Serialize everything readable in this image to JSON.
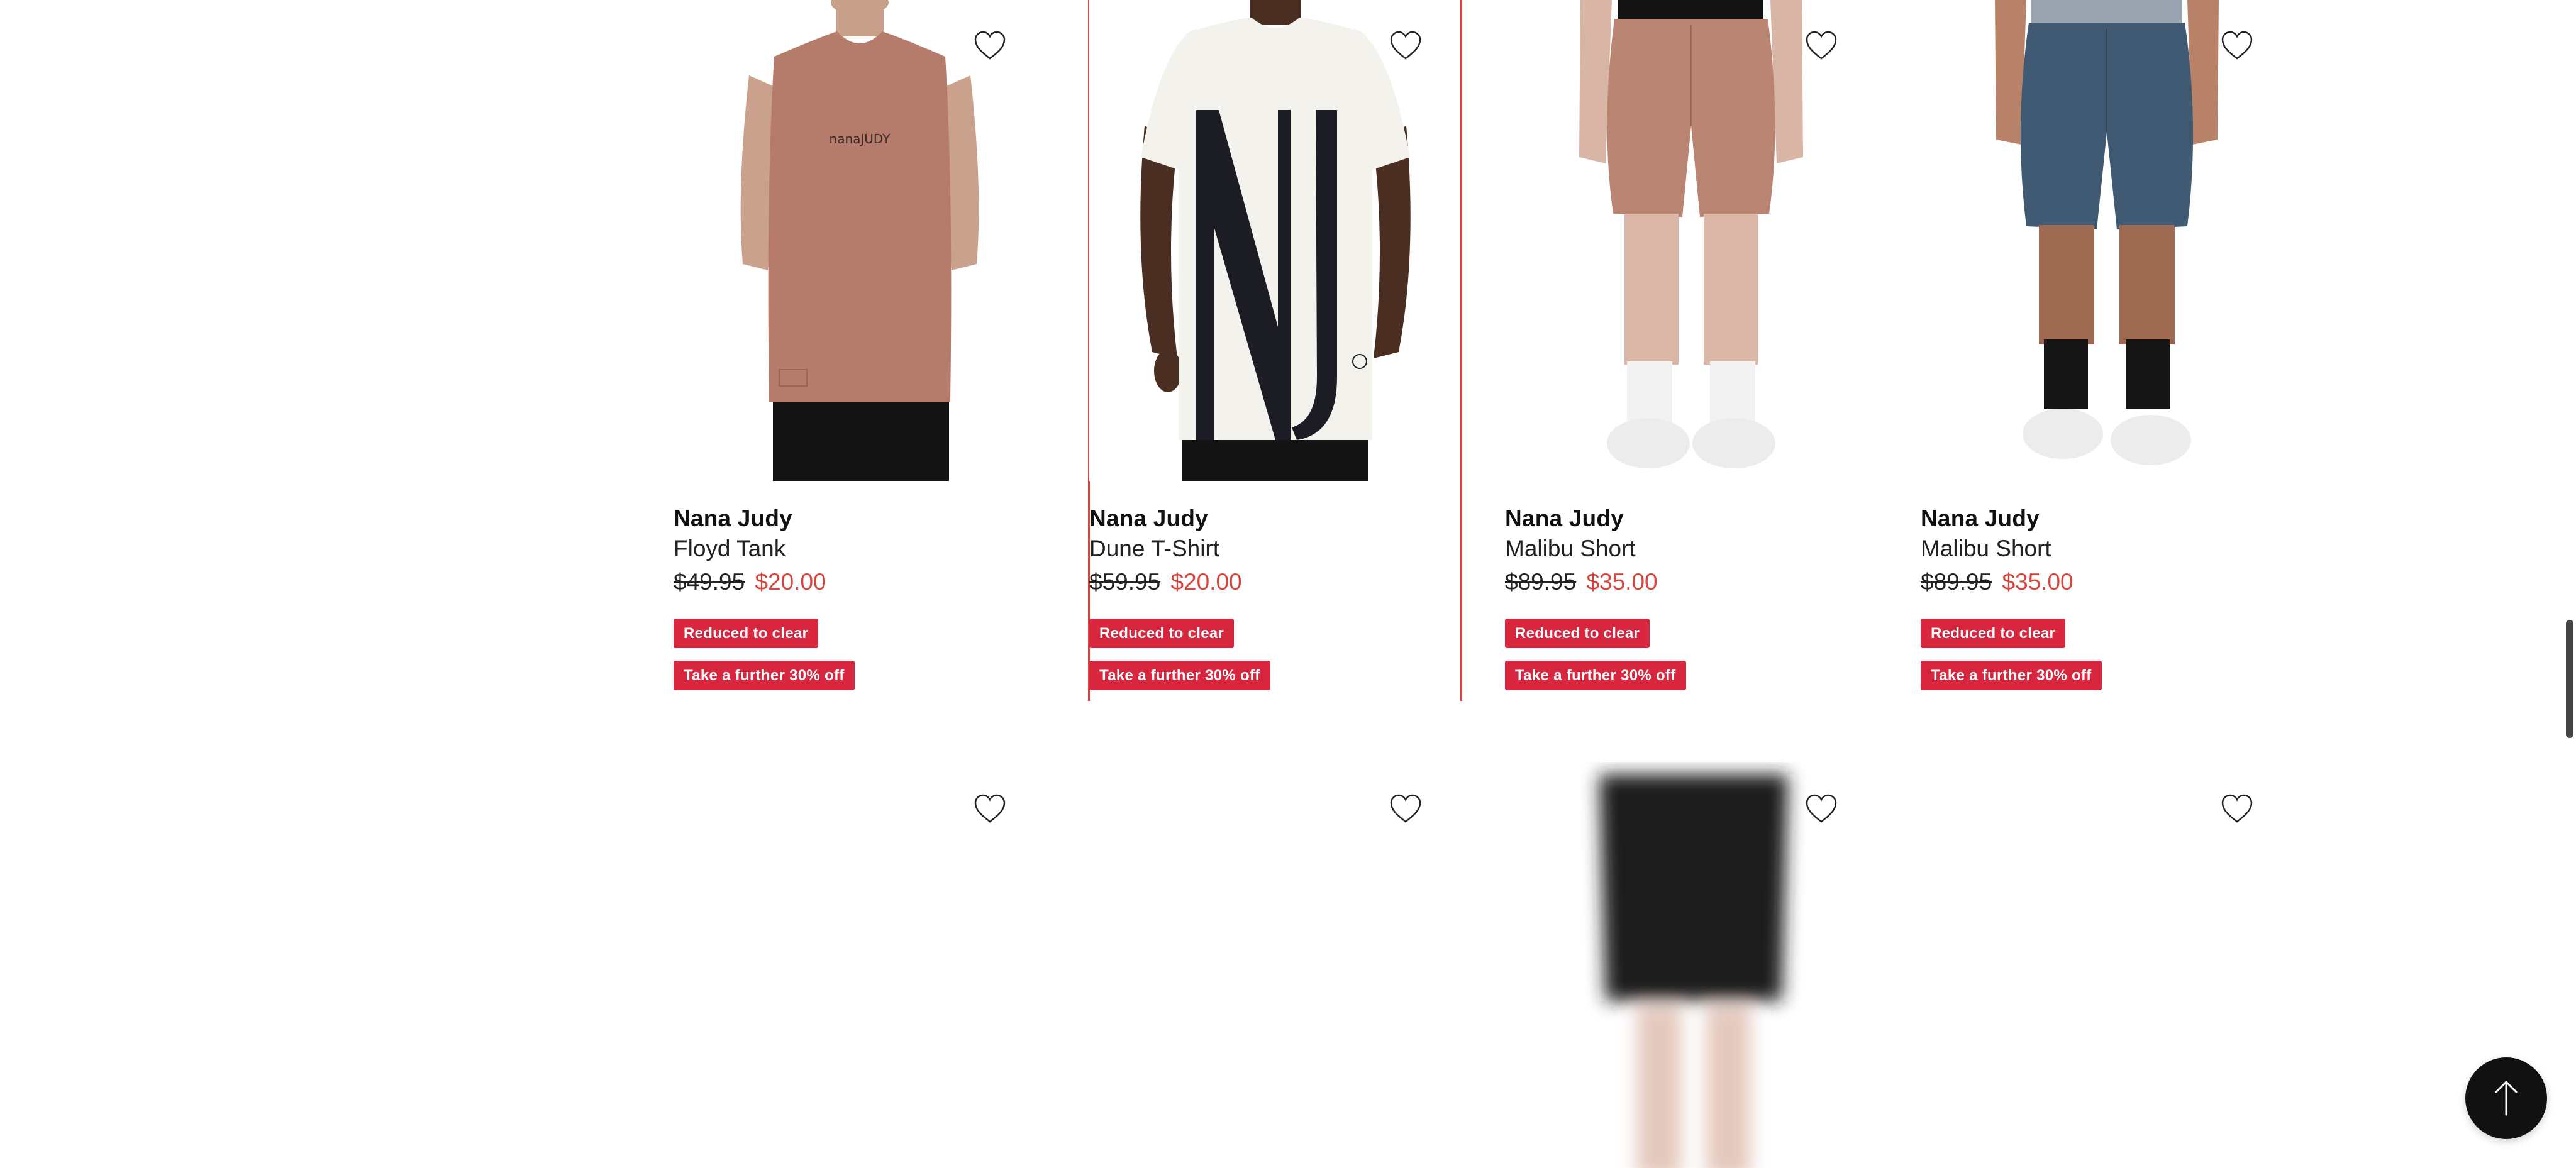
{
  "colors": {
    "sale_price": "#d8443c",
    "badge_background": "#d7263d",
    "badge_text": "#ffffff",
    "selected_outline": "#d8443c",
    "back_to_top": "#111111"
  },
  "products_row1": [
    {
      "brand": "Nana Judy",
      "name": "Floyd Tank",
      "was_price": "$49.95",
      "now_price": "$20.00",
      "badge_1": "Reduced to clear",
      "badge_2": "Take a further 30% off",
      "wishlist_icon": "heart-outline-icon",
      "image_colors": {
        "garment": "#b57c6b",
        "pants": "#141414"
      }
    },
    {
      "brand": "Nana Judy",
      "name": "Dune T-Shirt",
      "was_price": "$59.95",
      "now_price": "$20.00",
      "badge_1": "Reduced to clear",
      "badge_2": "Take a further 30% off",
      "wishlist_icon": "heart-outline-icon",
      "selected": true,
      "image_colors": {
        "garment": "#f4f2ec",
        "print": "#1c1c24",
        "pants": "#141414"
      }
    },
    {
      "brand": "Nana Judy",
      "name": "Malibu Short",
      "was_price": "$89.95",
      "now_price": "$35.00",
      "badge_1": "Reduced to clear",
      "badge_2": "Take a further 30% off",
      "wishlist_icon": "heart-outline-icon",
      "image_colors": {
        "garment": "#b98472"
      }
    },
    {
      "brand": "Nana Judy",
      "name": "Malibu Short",
      "was_price": "$89.95",
      "now_price": "$35.00",
      "badge_1": "Reduced to clear",
      "badge_2": "Take a further 30% off",
      "wishlist_icon": "heart-outline-icon",
      "image_colors": {
        "garment": "#3f5a72"
      }
    }
  ],
  "products_row2": [
    {
      "wishlist_icon": "heart-outline-icon",
      "image_state": "loading"
    },
    {
      "wishlist_icon": "heart-outline-icon",
      "image_state": "loading"
    },
    {
      "wishlist_icon": "heart-outline-icon",
      "image_state": "loading-blurred",
      "image_colors": {
        "garment": "#1c1c1c"
      }
    },
    {
      "wishlist_icon": "heart-outline-icon",
      "image_state": "loading"
    }
  ],
  "back_to_top_icon": "arrow-up-icon"
}
